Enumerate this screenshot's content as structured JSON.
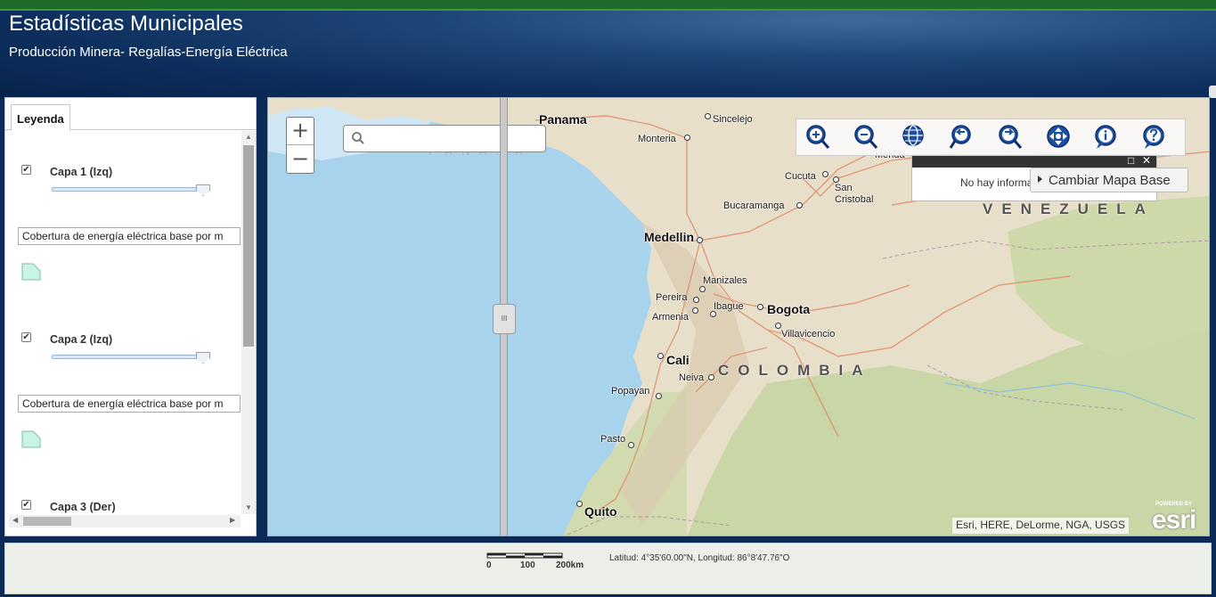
{
  "header": {
    "title": "Estadísticas Municipales",
    "subtitle": "Producción Minera- Regalías-Energía Eléctrica"
  },
  "legend_panel": {
    "tab_label": "Leyenda",
    "layers": [
      {
        "label": "Capa 1 (Izq)",
        "checked": true,
        "select_value": "Cobertura de energía eléctrica base por m",
        "swatch_color": "#c9f3e2"
      },
      {
        "label": "Capa 2 (Izq)",
        "checked": true,
        "select_value": "Cobertura de energía eléctrica base por m",
        "swatch_color": "#c9f3e2"
      },
      {
        "label": "Capa 3 (Der)",
        "checked": true
      }
    ]
  },
  "map": {
    "zoom_in_label": "+",
    "zoom_out_label": "−",
    "search_placeholder": "",
    "swipe_handle_label": "III",
    "toolbar_tools": [
      "zoom-in-tool",
      "zoom-out-tool",
      "full-extent-tool",
      "previous-extent-tool",
      "next-extent-tool",
      "pan-tool",
      "identify-tool",
      "help-tool"
    ],
    "popup_message": "No hay informa",
    "basemap_button": "Cambiar Mapa Base",
    "attribution": "Esri, HERE, DeLorme, NGA, USGS",
    "esri_powered": "POWERED BY",
    "esri_logo": "esri",
    "countries": {
      "venezuela": "VENEZUELA",
      "colombia": "COLOMBIA",
      "panama_faded": "PANAMA"
    },
    "cities": {
      "panama": "Panama",
      "sincelejo": "Sincelejo",
      "monteria": "Monteria",
      "merida": "Merida",
      "cucuta": "Cucuta",
      "san_cristobal_1": "San",
      "san_cristobal_2": "Cristobal",
      "bucaramanga": "Bucaramanga",
      "medellin": "Medellin",
      "manizales": "Manizales",
      "pereira": "Pereira",
      "ibague": "Ibague",
      "armenia": "Armenia",
      "bogota": "Bogota",
      "villavicencio": "Villavicencio",
      "cali": "Cali",
      "neiva": "Neiva",
      "popayan": "Popayan",
      "pasto": "Pasto",
      "quito": "Quito"
    },
    "colors": {
      "water": "#a7d3ec",
      "land": "#e8dfca",
      "forest": "#c9d6a5",
      "roads": "#e08e6a"
    }
  },
  "footer": {
    "scale_labels": [
      "0",
      "100",
      "200km"
    ],
    "coordinates": "Latitud: 4°35'60.00\"N, Longitud: 86°8'47.76\"O"
  }
}
